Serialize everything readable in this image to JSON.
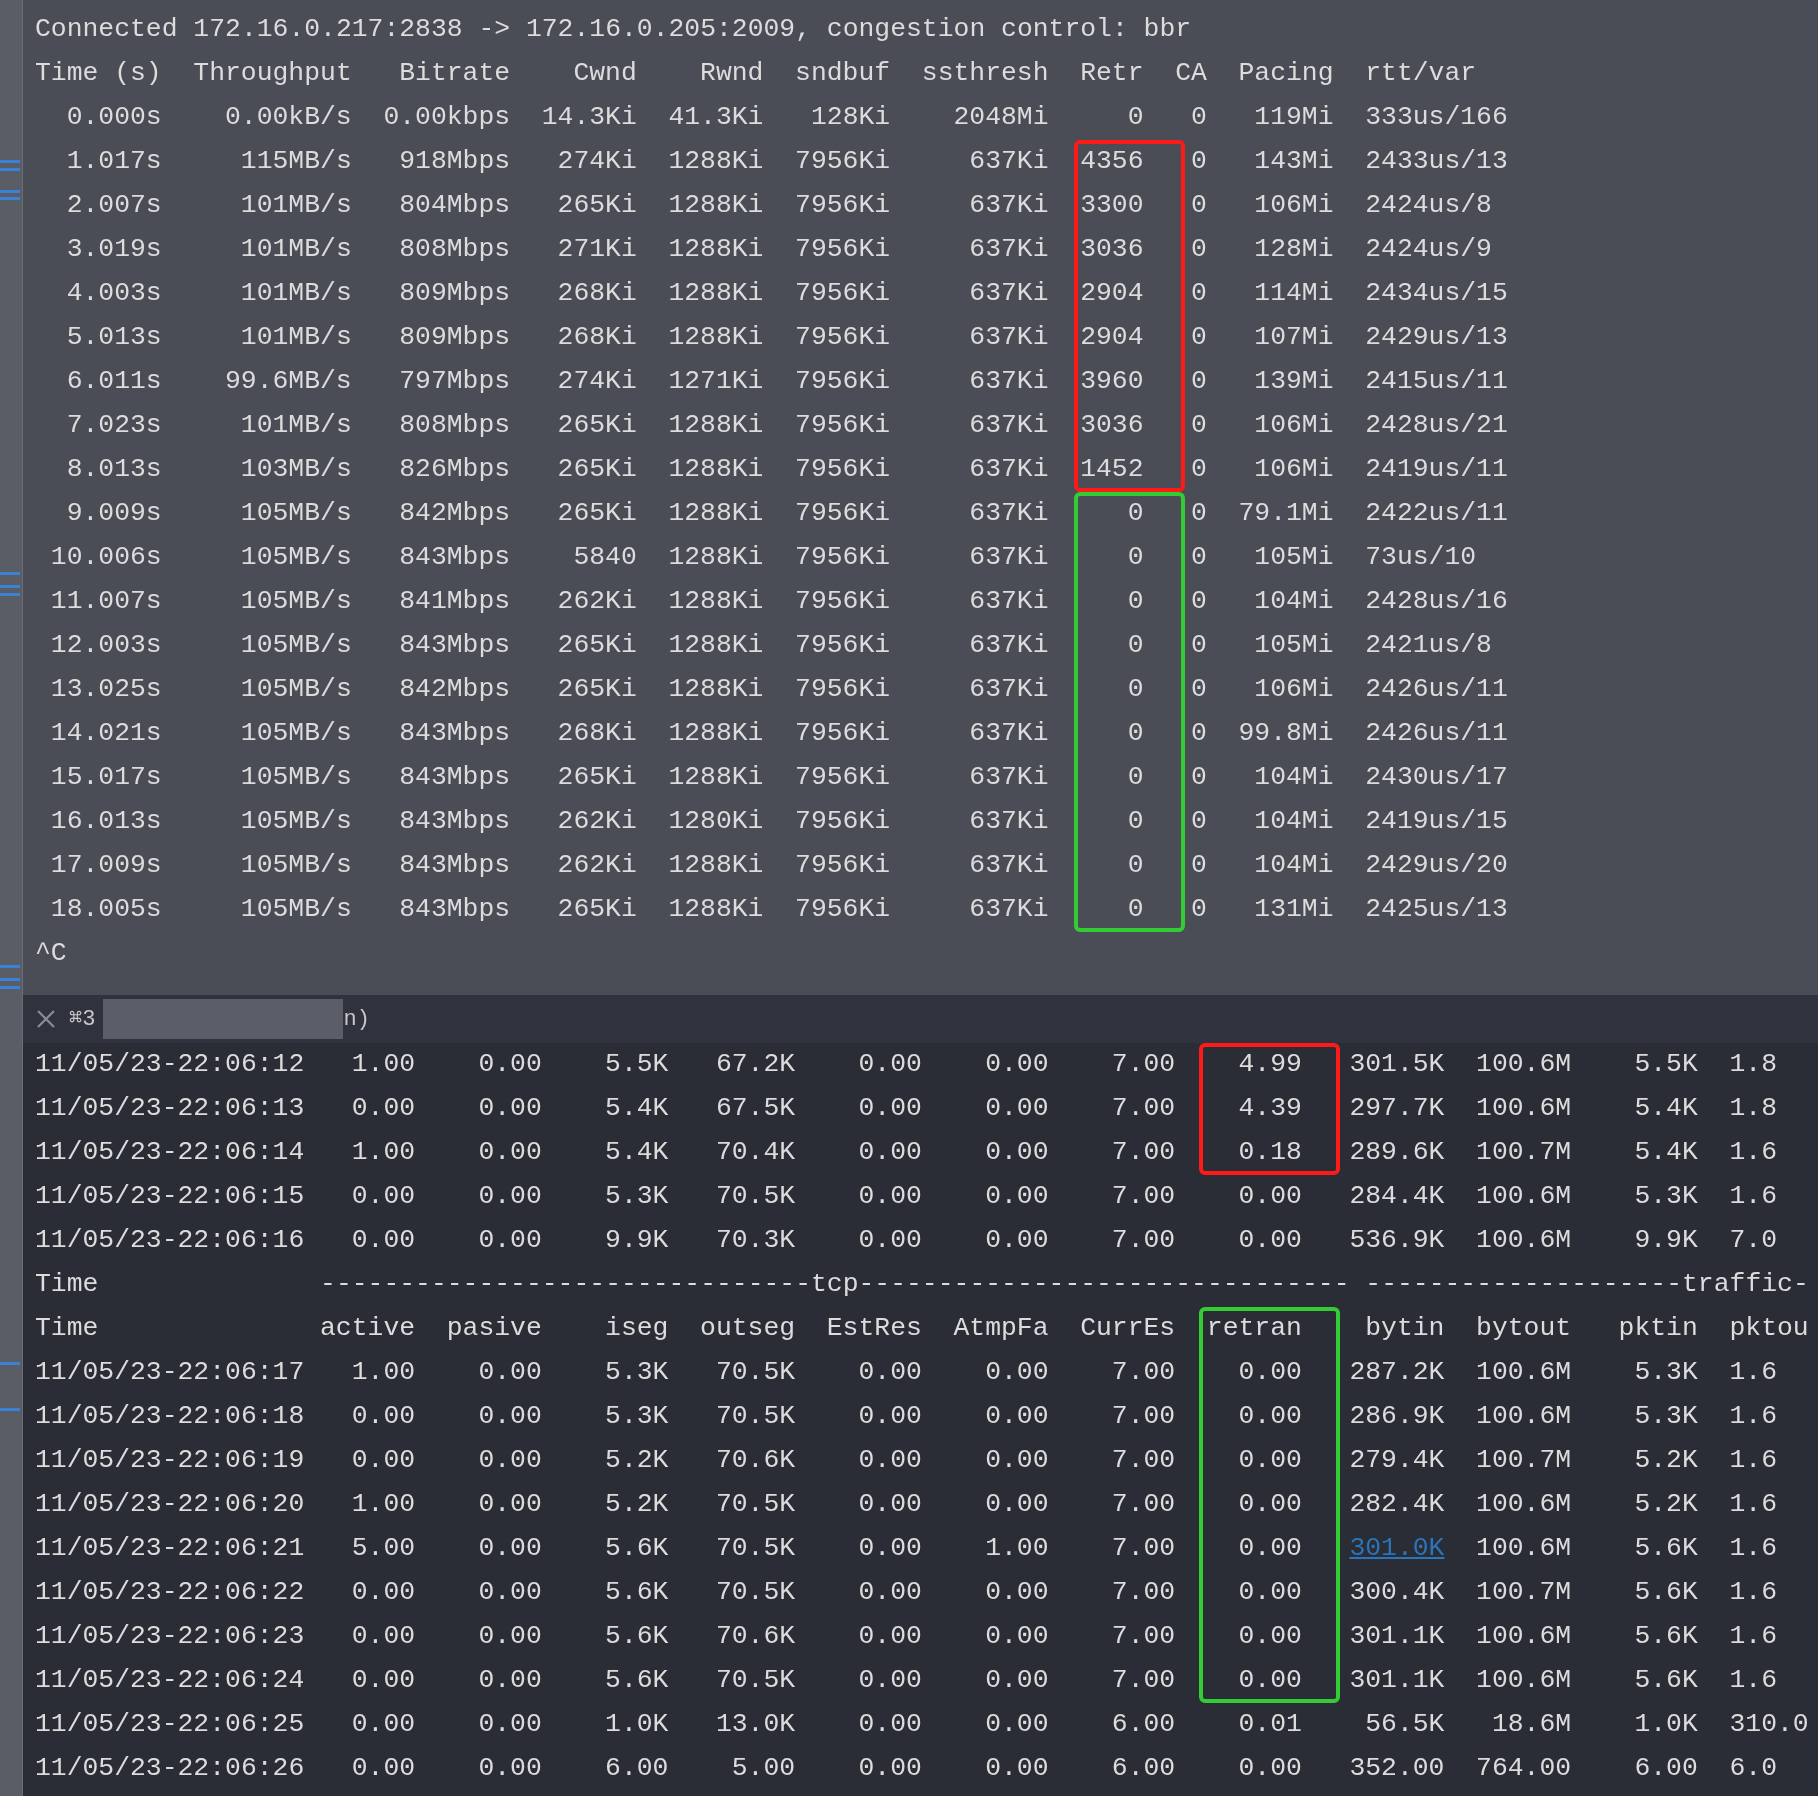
{
  "top": {
    "connection_line": "Connected 172.16.0.217:2838 -> 172.16.0.205:2009, congestion control: bbr",
    "header": [
      "Time (s)",
      "Throughput",
      "Bitrate",
      "Cwnd",
      "Rwnd",
      "sndbuf",
      "ssthresh",
      "Retr",
      "CA",
      "Pacing",
      "rtt/var"
    ],
    "groups": [
      {
        "rows": [
          [
            "0.000s",
            "0.00kB/s",
            "0.00kbps",
            "14.3Ki",
            "41.3Ki",
            "128Ki",
            "2048Mi",
            "0",
            "0",
            "119Mi",
            "333us/166"
          ]
        ]
      },
      {
        "color": "#ff1a1a",
        "rows": [
          [
            "1.017s",
            "115MB/s",
            "918Mbps",
            "274Ki",
            "1288Ki",
            "7956Ki",
            "637Ki",
            "4356",
            "0",
            "143Mi",
            "2433us/13"
          ],
          [
            "2.007s",
            "101MB/s",
            "804Mbps",
            "265Ki",
            "1288Ki",
            "7956Ki",
            "637Ki",
            "3300",
            "0",
            "106Mi",
            "2424us/8"
          ],
          [
            "3.019s",
            "101MB/s",
            "808Mbps",
            "271Ki",
            "1288Ki",
            "7956Ki",
            "637Ki",
            "3036",
            "0",
            "128Mi",
            "2424us/9"
          ],
          [
            "4.003s",
            "101MB/s",
            "809Mbps",
            "268Ki",
            "1288Ki",
            "7956Ki",
            "637Ki",
            "2904",
            "0",
            "114Mi",
            "2434us/15"
          ],
          [
            "5.013s",
            "101MB/s",
            "809Mbps",
            "268Ki",
            "1288Ki",
            "7956Ki",
            "637Ki",
            "2904",
            "0",
            "107Mi",
            "2429us/13"
          ],
          [
            "6.011s",
            "99.6MB/s",
            "797Mbps",
            "274Ki",
            "1271Ki",
            "7956Ki",
            "637Ki",
            "3960",
            "0",
            "139Mi",
            "2415us/11"
          ],
          [
            "7.023s",
            "101MB/s",
            "808Mbps",
            "265Ki",
            "1288Ki",
            "7956Ki",
            "637Ki",
            "3036",
            "0",
            "106Mi",
            "2428us/21"
          ],
          [
            "8.013s",
            "103MB/s",
            "826Mbps",
            "265Ki",
            "1288Ki",
            "7956Ki",
            "637Ki",
            "1452",
            "0",
            "106Mi",
            "2419us/11"
          ]
        ]
      },
      {
        "color": "#33cc33",
        "rows": [
          [
            "9.009s",
            "105MB/s",
            "842Mbps",
            "265Ki",
            "1288Ki",
            "7956Ki",
            "637Ki",
            "0",
            "0",
            "79.1Mi",
            "2422us/11"
          ],
          [
            "10.006s",
            "105MB/s",
            "843Mbps",
            "5840",
            "1288Ki",
            "7956Ki",
            "637Ki",
            "0",
            "0",
            "105Mi",
            "73us/10"
          ],
          [
            "11.007s",
            "105MB/s",
            "841Mbps",
            "262Ki",
            "1288Ki",
            "7956Ki",
            "637Ki",
            "0",
            "0",
            "104Mi",
            "2428us/16"
          ],
          [
            "12.003s",
            "105MB/s",
            "843Mbps",
            "265Ki",
            "1288Ki",
            "7956Ki",
            "637Ki",
            "0",
            "0",
            "105Mi",
            "2421us/8"
          ],
          [
            "13.025s",
            "105MB/s",
            "842Mbps",
            "265Ki",
            "1288Ki",
            "7956Ki",
            "637Ki",
            "0",
            "0",
            "106Mi",
            "2426us/11"
          ],
          [
            "14.021s",
            "105MB/s",
            "843Mbps",
            "268Ki",
            "1288Ki",
            "7956Ki",
            "637Ki",
            "0",
            "0",
            "99.8Mi",
            "2426us/11"
          ],
          [
            "15.017s",
            "105MB/s",
            "843Mbps",
            "265Ki",
            "1288Ki",
            "7956Ki",
            "637Ki",
            "0",
            "0",
            "104Mi",
            "2430us/17"
          ],
          [
            "16.013s",
            "105MB/s",
            "843Mbps",
            "262Ki",
            "1280Ki",
            "7956Ki",
            "637Ki",
            "0",
            "0",
            "104Mi",
            "2419us/15"
          ],
          [
            "17.009s",
            "105MB/s",
            "843Mbps",
            "262Ki",
            "1288Ki",
            "7956Ki",
            "637Ki",
            "0",
            "0",
            "104Mi",
            "2429us/20"
          ],
          [
            "18.005s",
            "105MB/s",
            "843Mbps",
            "265Ki",
            "1288Ki",
            "7956Ki",
            "637Ki",
            "0",
            "0",
            "131Mi",
            "2425us/13"
          ]
        ]
      }
    ],
    "interrupt": "^C"
  },
  "bottom": {
    "tab": {
      "shortcut": "⌘3",
      "title_end": "n)"
    },
    "groups": [
      {
        "color": "#ff1a1a",
        "rows": [
          {
            "kind": "data",
            "cells": [
              "11/05/23-22:06:12",
              "1.00",
              "0.00",
              "5.5K",
              "67.2K",
              "0.00",
              "0.00",
              "7.00",
              "4.99",
              "301.5K",
              "100.6M",
              "5.5K",
              "1.8"
            ]
          },
          {
            "kind": "data",
            "cells": [
              "11/05/23-22:06:13",
              "0.00",
              "0.00",
              "5.4K",
              "67.5K",
              "0.00",
              "0.00",
              "7.00",
              "4.39",
              "297.7K",
              "100.6M",
              "5.4K",
              "1.8"
            ]
          },
          {
            "kind": "data",
            "cells": [
              "11/05/23-22:06:14",
              "1.00",
              "0.00",
              "5.4K",
              "70.4K",
              "0.00",
              "0.00",
              "7.00",
              "0.18",
              "289.6K",
              "100.7M",
              "5.4K",
              "1.6"
            ]
          }
        ]
      },
      {
        "rows": [
          {
            "kind": "data",
            "cells": [
              "11/05/23-22:06:15",
              "0.00",
              "0.00",
              "5.3K",
              "70.5K",
              "0.00",
              "0.00",
              "7.00",
              "0.00",
              "284.4K",
              "100.6M",
              "5.3K",
              "1.6"
            ]
          },
          {
            "kind": "data",
            "cells": [
              "11/05/23-22:06:16",
              "0.00",
              "0.00",
              "9.9K",
              "70.3K",
              "0.00",
              "0.00",
              "7.00",
              "0.00",
              "536.9K",
              "100.6M",
              "9.9K",
              "7.0"
            ]
          },
          {
            "kind": "rule",
            "label": "Time",
            "tcp_rule": "-------------------------------tcp-------------------------------",
            "traffic_rule": "--------------------traffic-"
          }
        ]
      },
      {
        "color": "#33cc33",
        "rows": [
          {
            "kind": "header",
            "cells": [
              "Time",
              "active",
              "pasive",
              "iseg",
              "outseg",
              "EstRes",
              "AtmpFa",
              "CurrEs",
              "retran",
              "bytin",
              "bytout",
              "pktin",
              "pktou"
            ]
          },
          {
            "kind": "data",
            "cells": [
              "11/05/23-22:06:17",
              "1.00",
              "0.00",
              "5.3K",
              "70.5K",
              "0.00",
              "0.00",
              "7.00",
              "0.00",
              "287.2K",
              "100.6M",
              "5.3K",
              "1.6"
            ]
          },
          {
            "kind": "data",
            "cells": [
              "11/05/23-22:06:18",
              "0.00",
              "0.00",
              "5.3K",
              "70.5K",
              "0.00",
              "0.00",
              "7.00",
              "0.00",
              "286.9K",
              "100.6M",
              "5.3K",
              "1.6"
            ]
          },
          {
            "kind": "data",
            "cells": [
              "11/05/23-22:06:19",
              "0.00",
              "0.00",
              "5.2K",
              "70.6K",
              "0.00",
              "0.00",
              "7.00",
              "0.00",
              "279.4K",
              "100.7M",
              "5.2K",
              "1.6"
            ]
          },
          {
            "kind": "data",
            "cells": [
              "11/05/23-22:06:20",
              "1.00",
              "0.00",
              "5.2K",
              "70.5K",
              "0.00",
              "0.00",
              "7.00",
              "0.00",
              "282.4K",
              "100.6M",
              "5.2K",
              "1.6"
            ]
          },
          {
            "kind": "data",
            "cells": [
              "11/05/23-22:06:21",
              "5.00",
              "0.00",
              "5.6K",
              "70.5K",
              "0.00",
              "1.00",
              "7.00",
              "0.00",
              {
                "kind": "link",
                "text": "301.0K"
              },
              "100.6M",
              "5.6K",
              "1.6"
            ]
          },
          {
            "kind": "data",
            "cells": [
              "11/05/23-22:06:22",
              "0.00",
              "0.00",
              "5.6K",
              "70.5K",
              "0.00",
              "0.00",
              "7.00",
              "0.00",
              "300.4K",
              "100.7M",
              "5.6K",
              "1.6"
            ]
          },
          {
            "kind": "data",
            "cells": [
              "11/05/23-22:06:23",
              "0.00",
              "0.00",
              "5.6K",
              "70.6K",
              "0.00",
              "0.00",
              "7.00",
              "0.00",
              "301.1K",
              "100.6M",
              "5.6K",
              "1.6"
            ]
          },
          {
            "kind": "data",
            "cells": [
              "11/05/23-22:06:24",
              "0.00",
              "0.00",
              "5.6K",
              "70.5K",
              "0.00",
              "0.00",
              "7.00",
              "0.00",
              "301.1K",
              "100.6M",
              "5.6K",
              "1.6"
            ]
          }
        ]
      },
      {
        "rows": [
          {
            "kind": "data",
            "cells": [
              "11/05/23-22:06:25",
              "0.00",
              "0.00",
              "1.0K",
              "13.0K",
              "0.00",
              "0.00",
              "6.00",
              "0.01",
              "56.5K",
              "18.6M",
              "1.0K",
              "310.0"
            ]
          },
          {
            "kind": "data",
            "cells": [
              "11/05/23-22:06:26",
              "0.00",
              "0.00",
              "6.00",
              "5.00",
              "0.00",
              "0.00",
              "6.00",
              "0.00",
              "352.00",
              "764.00",
              "6.00",
              "6.0"
            ]
          }
        ]
      }
    ]
  }
}
